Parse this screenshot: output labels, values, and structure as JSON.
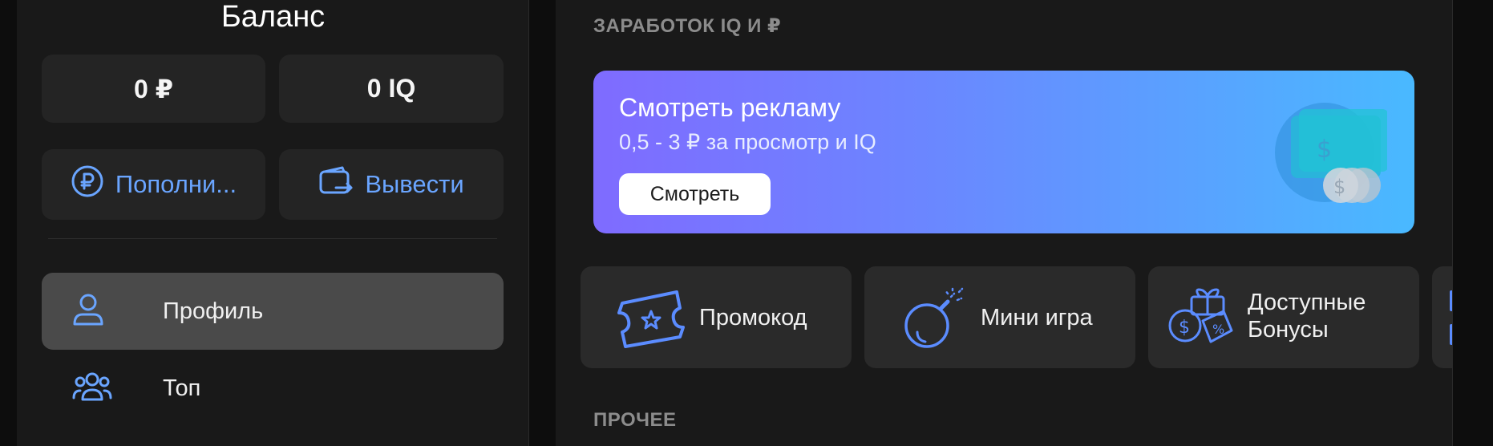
{
  "balance": {
    "title": "Баланс",
    "rub": "0 ₽",
    "iq": "0 IQ",
    "topup_label": "Пополни...",
    "withdraw_label": "Вывести"
  },
  "nav": {
    "items": [
      {
        "label": "Профиль",
        "active": true,
        "icon": "user-icon"
      },
      {
        "label": "Топ",
        "active": false,
        "icon": "users-group-icon"
      }
    ]
  },
  "earn": {
    "section_title": "ЗАРАБОТОК IQ И ₽",
    "ad": {
      "title": "Смотреть рекламу",
      "subtitle": "0,5 - 3 ₽ за просмотр и IQ",
      "button": "Смотреть",
      "art_icon": "money-coins-icon"
    },
    "cards": [
      {
        "label": "Промокод",
        "icon": "ticket-star-icon"
      },
      {
        "label": "Мини игра",
        "icon": "bomb-icon"
      },
      {
        "label_line1": "Доступные",
        "label_line2": "Бонусы",
        "icon": "bonus-gift-icon"
      }
    ]
  },
  "other": {
    "section_title": "ПРОЧЕЕ"
  },
  "colors": {
    "accent": "#6aa5ff",
    "panel": "#191919",
    "tile": "#242424",
    "active_nav": "#4a4a4a"
  }
}
